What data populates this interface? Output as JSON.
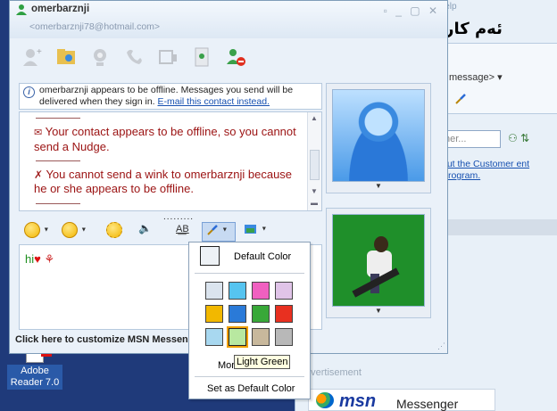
{
  "overlay": {
    "caption": "ئەم کارە بۆ:"
  },
  "conversation": {
    "title_name": "omerbarznji",
    "title_email": "<omerbarznji78@hotmail.com>",
    "window_controls": "▫ _ ▢ ✕",
    "info_text": "omerbarznji appears to be offline. Messages you send will be delivered when they sign in.",
    "info_link": "E-mail this contact instead.",
    "history": [
      {
        "icon": "envelope-icon",
        "glyph": "✉",
        "text": "Your contact appears to be offline, so you cannot send a Nudge."
      },
      {
        "icon": "wink-icon",
        "glyph": "✗",
        "text": "You cannot send a wink to omerbarznji because he or she appears to be offline."
      }
    ],
    "compose_text": "hi",
    "bottom_ad": "Click here to customize MSN Messenger",
    "splitter": "........."
  },
  "color_picker": {
    "default_label": "Default Color",
    "more_label": "More",
    "set_default_label": "Set as Default Color",
    "tooltip": "Light Green",
    "selected": "Light Green",
    "rows": [
      [
        "#dbe4ee",
        "#56c4f0",
        "#f060c0",
        "#e0c4e8"
      ],
      [
        "#f2b800",
        "#2a7ad8",
        "#38a838",
        "#e83020"
      ],
      [
        "#a8d8f0",
        "#b8e8a0",
        "#c8b89c",
        "#b8b8b8"
      ]
    ]
  },
  "background_window": {
    "help": "Help",
    "status": "message>",
    "search_placeholder": "ner...",
    "link_text": "out the Customer ent Program.",
    "advertisement": "dvertisement",
    "msn": "msn",
    "messenger": "Messenger"
  },
  "desktop": {
    "icon_label": "Adobe Reader 7.0"
  }
}
